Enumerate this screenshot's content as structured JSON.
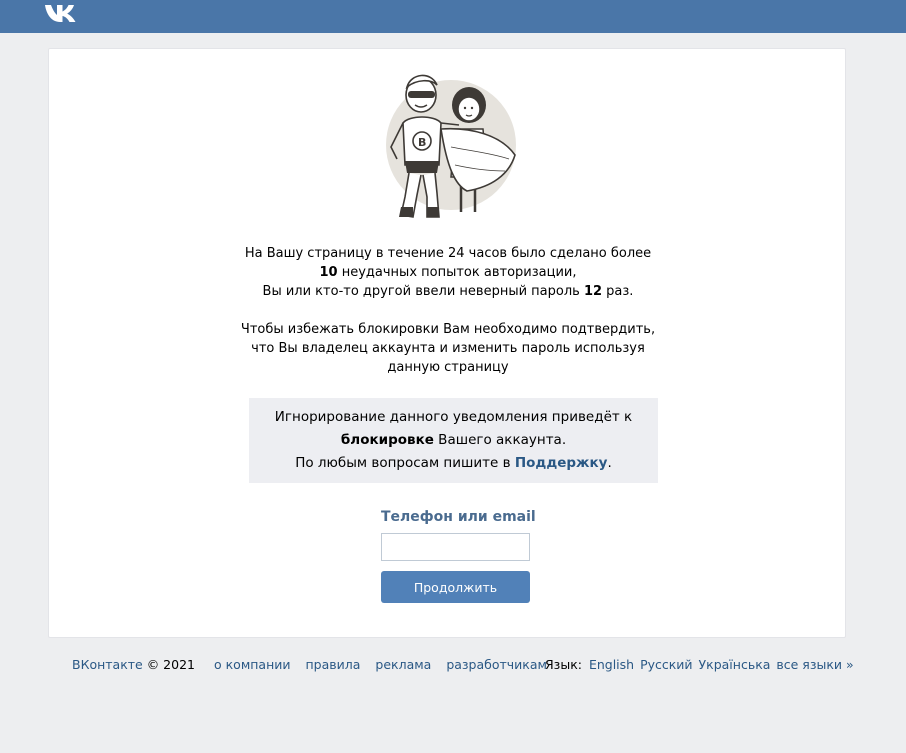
{
  "header": {
    "logo_text": "VK"
  },
  "message": {
    "line1": "На Вашу страницу в течение 24 часов было сделано более",
    "attempts_count": "10",
    "line2_rest": " неудачных попыток авторизации,",
    "line3_start": "Вы или кто-то другой ввели неверный пароль ",
    "wrong_count": "12",
    "line3_end": " раз.",
    "line4": "Чтобы избежать блокировки Вам необходимо подтвердить,",
    "line5": "что Вы владелец аккаунта и изменить пароль используя",
    "line6": "данную страницу"
  },
  "notice": {
    "line1": "Игнорирование данного уведомления приведёт к",
    "bold_word": "блокировке",
    "line2_rest": " Вашего аккаунта.",
    "line3_start": "По любым вопросам пишите в ",
    "support_link": "Поддержку",
    "line3_end": "."
  },
  "form": {
    "label": "Телефон или email",
    "input_value": "",
    "input_placeholder": "",
    "button_label": "Продолжить"
  },
  "footer": {
    "brand": "ВКонтакте",
    "copyright": " © 2021",
    "links": [
      "о компании",
      "правила",
      "реклама",
      "разработчикам"
    ],
    "language_label": "Язык:",
    "languages": [
      "English",
      "Русский",
      "Українська",
      "все языки »"
    ]
  },
  "colors": {
    "header_bg": "#4a76a8",
    "page_bg": "#edeef0",
    "button_bg": "#5181b8",
    "link": "#2a5885",
    "label": "#4a6b8f"
  }
}
